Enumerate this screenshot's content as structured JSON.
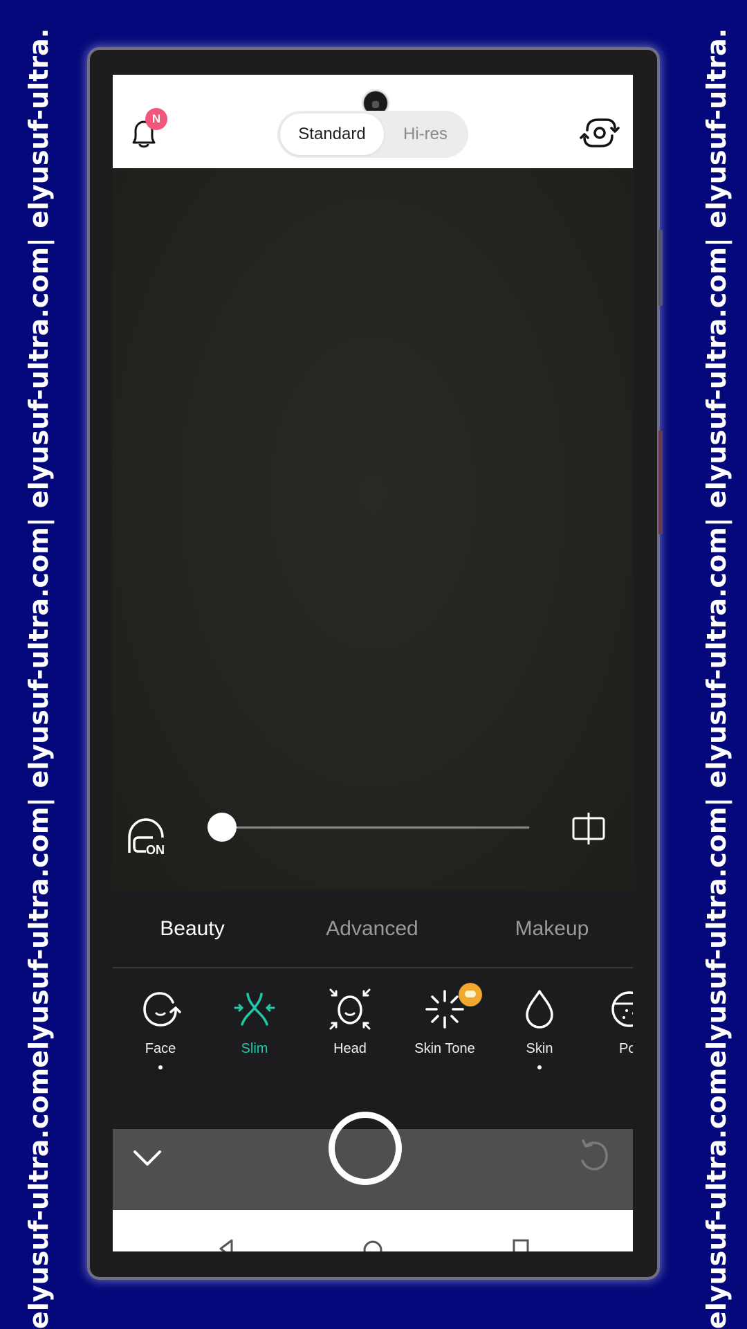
{
  "watermark": {
    "left_text": "elyusuf-ultra.comelyusuf-ultra.com| elyusuf-ultra.com| elyusuf-ultra.com| elyusuf-ultra.",
    "right_text": "elyusuf-ultra.comelyusuf-ultra.com| elyusuf-ultra.com| elyusuf-ultra.com| elyusuf-ultra."
  },
  "header": {
    "notification_badge": "N",
    "quality_options": [
      {
        "label": "Standard",
        "selected": true
      },
      {
        "label": "Hi-res",
        "selected": false
      }
    ]
  },
  "slider": {
    "beauty_toggle_label": "ON",
    "value_fraction": 0.0
  },
  "tabs": [
    {
      "label": "Beauty",
      "active": true
    },
    {
      "label": "Advanced",
      "active": false
    },
    {
      "label": "Makeup",
      "active": false
    }
  ],
  "tools": [
    {
      "label": "Face",
      "icon": "face-icon",
      "active": false,
      "dot": true,
      "new_badge": false
    },
    {
      "label": "Slim",
      "icon": "slim-icon",
      "active": true,
      "dot": false,
      "new_badge": false
    },
    {
      "label": "Head",
      "icon": "head-icon",
      "active": false,
      "dot": false,
      "new_badge": false
    },
    {
      "label": "Skin Tone",
      "icon": "sparkle-icon",
      "active": false,
      "dot": false,
      "new_badge": true
    },
    {
      "label": "Skin",
      "icon": "droplet-icon",
      "active": false,
      "dot": true,
      "new_badge": false
    },
    {
      "label": "Po",
      "icon": "pores-icon",
      "active": false,
      "dot": false,
      "new_badge": false
    }
  ],
  "colors": {
    "accent": "#21c8a8",
    "badge": "#f2567a",
    "new_badge": "#f0a830",
    "background": "#05087a"
  }
}
